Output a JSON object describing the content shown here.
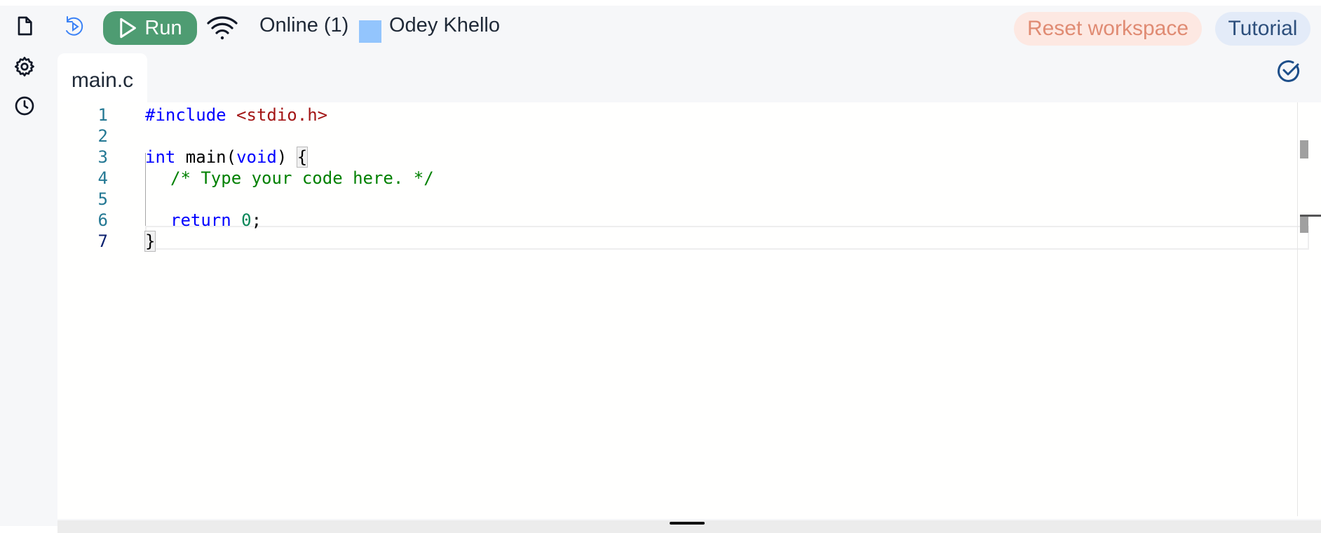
{
  "toolbar": {
    "run_label": "Run",
    "online_status": "Online (1)",
    "user_name": "Odey Khello",
    "user_color": "#93c5fd",
    "reset_label": "Reset workspace",
    "tutorial_label": "Tutorial",
    "run_color": "#4e9c72"
  },
  "sidebar": {
    "icons": [
      "file-icon",
      "gear-icon",
      "clock-icon"
    ]
  },
  "tabs": [
    {
      "label": "main.c",
      "active": true
    }
  ],
  "editor": {
    "line_numbers": [
      "1",
      "2",
      "3",
      "4",
      "5",
      "6",
      "7"
    ],
    "active_line": 7,
    "code": {
      "include_directive": "#include",
      "include_header": "<stdio.h>",
      "int_kw": "int",
      "main_name": " main(",
      "void_kw": "void",
      "main_close": ") ",
      "open_brace": "{",
      "comment": "/* Type your code here. */",
      "return_kw": "return",
      "return_value": "0",
      "semicolon": ";",
      "close_brace": "}"
    }
  }
}
